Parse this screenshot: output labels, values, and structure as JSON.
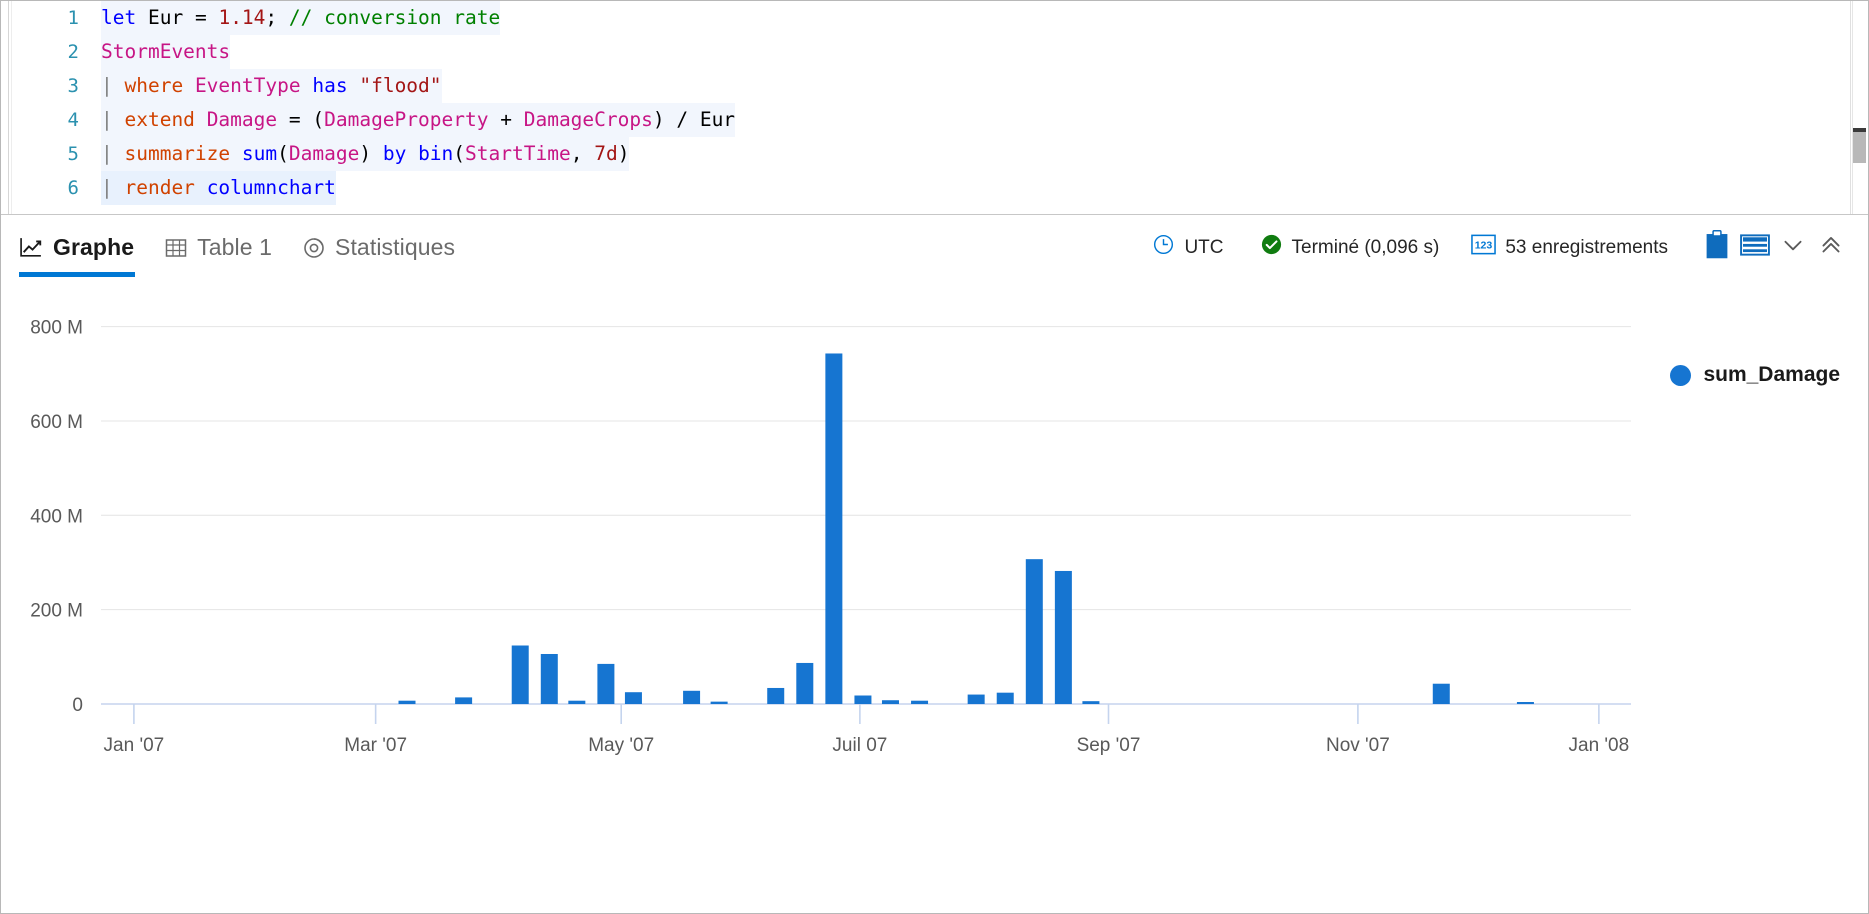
{
  "editor": {
    "lines": [
      {
        "number": "1",
        "tokens": [
          {
            "t": "let",
            "c": "k-blue"
          },
          {
            "t": " ",
            "c": "k-punc"
          },
          {
            "t": "Eur",
            "c": "k-id"
          },
          {
            "t": " = ",
            "c": "k-punc"
          },
          {
            "t": "1.14",
            "c": "k-num"
          },
          {
            "t": ";",
            "c": "k-punc"
          },
          {
            "t": " ",
            "c": "k-punc"
          },
          {
            "t": "// conversion rate",
            "c": "k-com"
          }
        ]
      },
      {
        "number": "2",
        "tokens": [
          {
            "t": "StormEvents",
            "c": "k-tbl"
          }
        ]
      },
      {
        "number": "3",
        "tokens": [
          {
            "t": "| ",
            "c": "k-pipe"
          },
          {
            "t": "where",
            "c": "k-kw"
          },
          {
            "t": " ",
            "c": "k-punc"
          },
          {
            "t": "EventType",
            "c": "k-tbl"
          },
          {
            "t": " ",
            "c": "k-punc"
          },
          {
            "t": "has",
            "c": "k-blue"
          },
          {
            "t": " ",
            "c": "k-punc"
          },
          {
            "t": "\"flood\"",
            "c": "k-str"
          }
        ]
      },
      {
        "number": "4",
        "tokens": [
          {
            "t": "| ",
            "c": "k-pipe"
          },
          {
            "t": "extend",
            "c": "k-kw"
          },
          {
            "t": " ",
            "c": "k-punc"
          },
          {
            "t": "Damage",
            "c": "k-tbl"
          },
          {
            "t": " = (",
            "c": "k-punc"
          },
          {
            "t": "DamageProperty",
            "c": "k-tbl"
          },
          {
            "t": " + ",
            "c": "k-punc"
          },
          {
            "t": "DamageCrops",
            "c": "k-tbl"
          },
          {
            "t": ") / ",
            "c": "k-punc"
          },
          {
            "t": "Eur",
            "c": "k-id"
          }
        ]
      },
      {
        "number": "5",
        "tokens": [
          {
            "t": "| ",
            "c": "k-pipe"
          },
          {
            "t": "summarize",
            "c": "k-kw"
          },
          {
            "t": " ",
            "c": "k-punc"
          },
          {
            "t": "sum",
            "c": "k-fn"
          },
          {
            "t": "(",
            "c": "k-punc"
          },
          {
            "t": "Damage",
            "c": "k-tbl"
          },
          {
            "t": ") ",
            "c": "k-punc"
          },
          {
            "t": "by",
            "c": "k-blue"
          },
          {
            "t": " ",
            "c": "k-punc"
          },
          {
            "t": "bin",
            "c": "k-fn"
          },
          {
            "t": "(",
            "c": "k-punc"
          },
          {
            "t": "StartTime",
            "c": "k-tbl"
          },
          {
            "t": ", ",
            "c": "k-punc"
          },
          {
            "t": "7d",
            "c": "k-num"
          },
          {
            "t": ")",
            "c": "k-punc"
          }
        ]
      },
      {
        "number": "6",
        "tokens": [
          {
            "t": "| ",
            "c": "k-pipe"
          },
          {
            "t": "render",
            "c": "k-kw"
          },
          {
            "t": " ",
            "c": "k-punc"
          },
          {
            "t": "columnchart",
            "c": "k-blue"
          }
        ]
      }
    ]
  },
  "results": {
    "tabs": [
      {
        "label": "Graphe",
        "icon": "line-chart-icon",
        "active": true
      },
      {
        "label": "Table 1",
        "icon": "table-icon",
        "active": false
      },
      {
        "label": "Statistiques",
        "icon": "donut-chart-icon",
        "active": false
      }
    ],
    "status": {
      "timezone": "UTC",
      "timezone_icon": "clock-icon",
      "completion": "Terminé (0,096 s)",
      "completion_icon": "check-circle-icon",
      "records": "53 enregistrements",
      "records_icon": "123-icon"
    },
    "actions": [
      {
        "name": "clipboard-button",
        "icon": "clipboard-icon"
      },
      {
        "name": "table-layout-button",
        "icon": "table-rows-icon"
      },
      {
        "name": "expand-more-button",
        "icon": "chevron-down-icon"
      },
      {
        "name": "collapse-button",
        "icon": "double-chevron-up-icon"
      }
    ]
  },
  "legend": {
    "series_label": "sum_Damage",
    "color": "#1675d1"
  },
  "colors": {
    "accent": "#0078d4",
    "bar": "#1675d1",
    "grid": "#e4e4e4",
    "axis": "#c5d4ee",
    "tick_text": "#595959"
  },
  "chart_data": {
    "type": "bar",
    "title": "",
    "xlabel": "",
    "ylabel": "",
    "ylim": [
      0,
      850000000
    ],
    "grid": true,
    "legend_position": "right",
    "y_ticks": [
      {
        "value": 0,
        "label": "0"
      },
      {
        "value": 200000000,
        "label": "200 M"
      },
      {
        "value": 400000000,
        "label": "400 M"
      },
      {
        "value": 600000000,
        "label": "600 M"
      },
      {
        "value": 800000000,
        "label": "800 M"
      }
    ],
    "x_ticks": [
      {
        "pos": 0.0215,
        "label": "Jan '07"
      },
      {
        "pos": 0.1795,
        "label": "Mar '07"
      },
      {
        "pos": 0.34,
        "label": "May '07"
      },
      {
        "pos": 0.496,
        "label": "Juil 07"
      },
      {
        "pos": 0.6585,
        "label": "Sep '07"
      },
      {
        "pos": 0.8215,
        "label": "Nov '07"
      },
      {
        "pos": 0.979,
        "label": "Jan '08"
      }
    ],
    "series": [
      {
        "name": "sum_Damage",
        "color": "#1675d1",
        "points": [
          {
            "x": 0.2,
            "y": 7000000
          },
          {
            "x": 0.237,
            "y": 14000000
          },
          {
            "x": 0.274,
            "y": 124000000
          },
          {
            "x": 0.293,
            "y": 106000000
          },
          {
            "x": 0.311,
            "y": 7000000
          },
          {
            "x": 0.33,
            "y": 85000000
          },
          {
            "x": 0.348,
            "y": 25000000
          },
          {
            "x": 0.386,
            "y": 28000000
          },
          {
            "x": 0.404,
            "y": 5000000
          },
          {
            "x": 0.441,
            "y": 34000000
          },
          {
            "x": 0.46,
            "y": 87000000
          },
          {
            "x": 0.479,
            "y": 743000000
          },
          {
            "x": 0.498,
            "y": 18000000
          },
          {
            "x": 0.516,
            "y": 8000000
          },
          {
            "x": 0.535,
            "y": 7000000
          },
          {
            "x": 0.572,
            "y": 20000000
          },
          {
            "x": 0.591,
            "y": 24000000
          },
          {
            "x": 0.61,
            "y": 307000000
          },
          {
            "x": 0.629,
            "y": 282000000
          },
          {
            "x": 0.647,
            "y": 6000000
          },
          {
            "x": 0.876,
            "y": 43000000
          },
          {
            "x": 0.931,
            "y": 4000000
          }
        ]
      }
    ]
  }
}
